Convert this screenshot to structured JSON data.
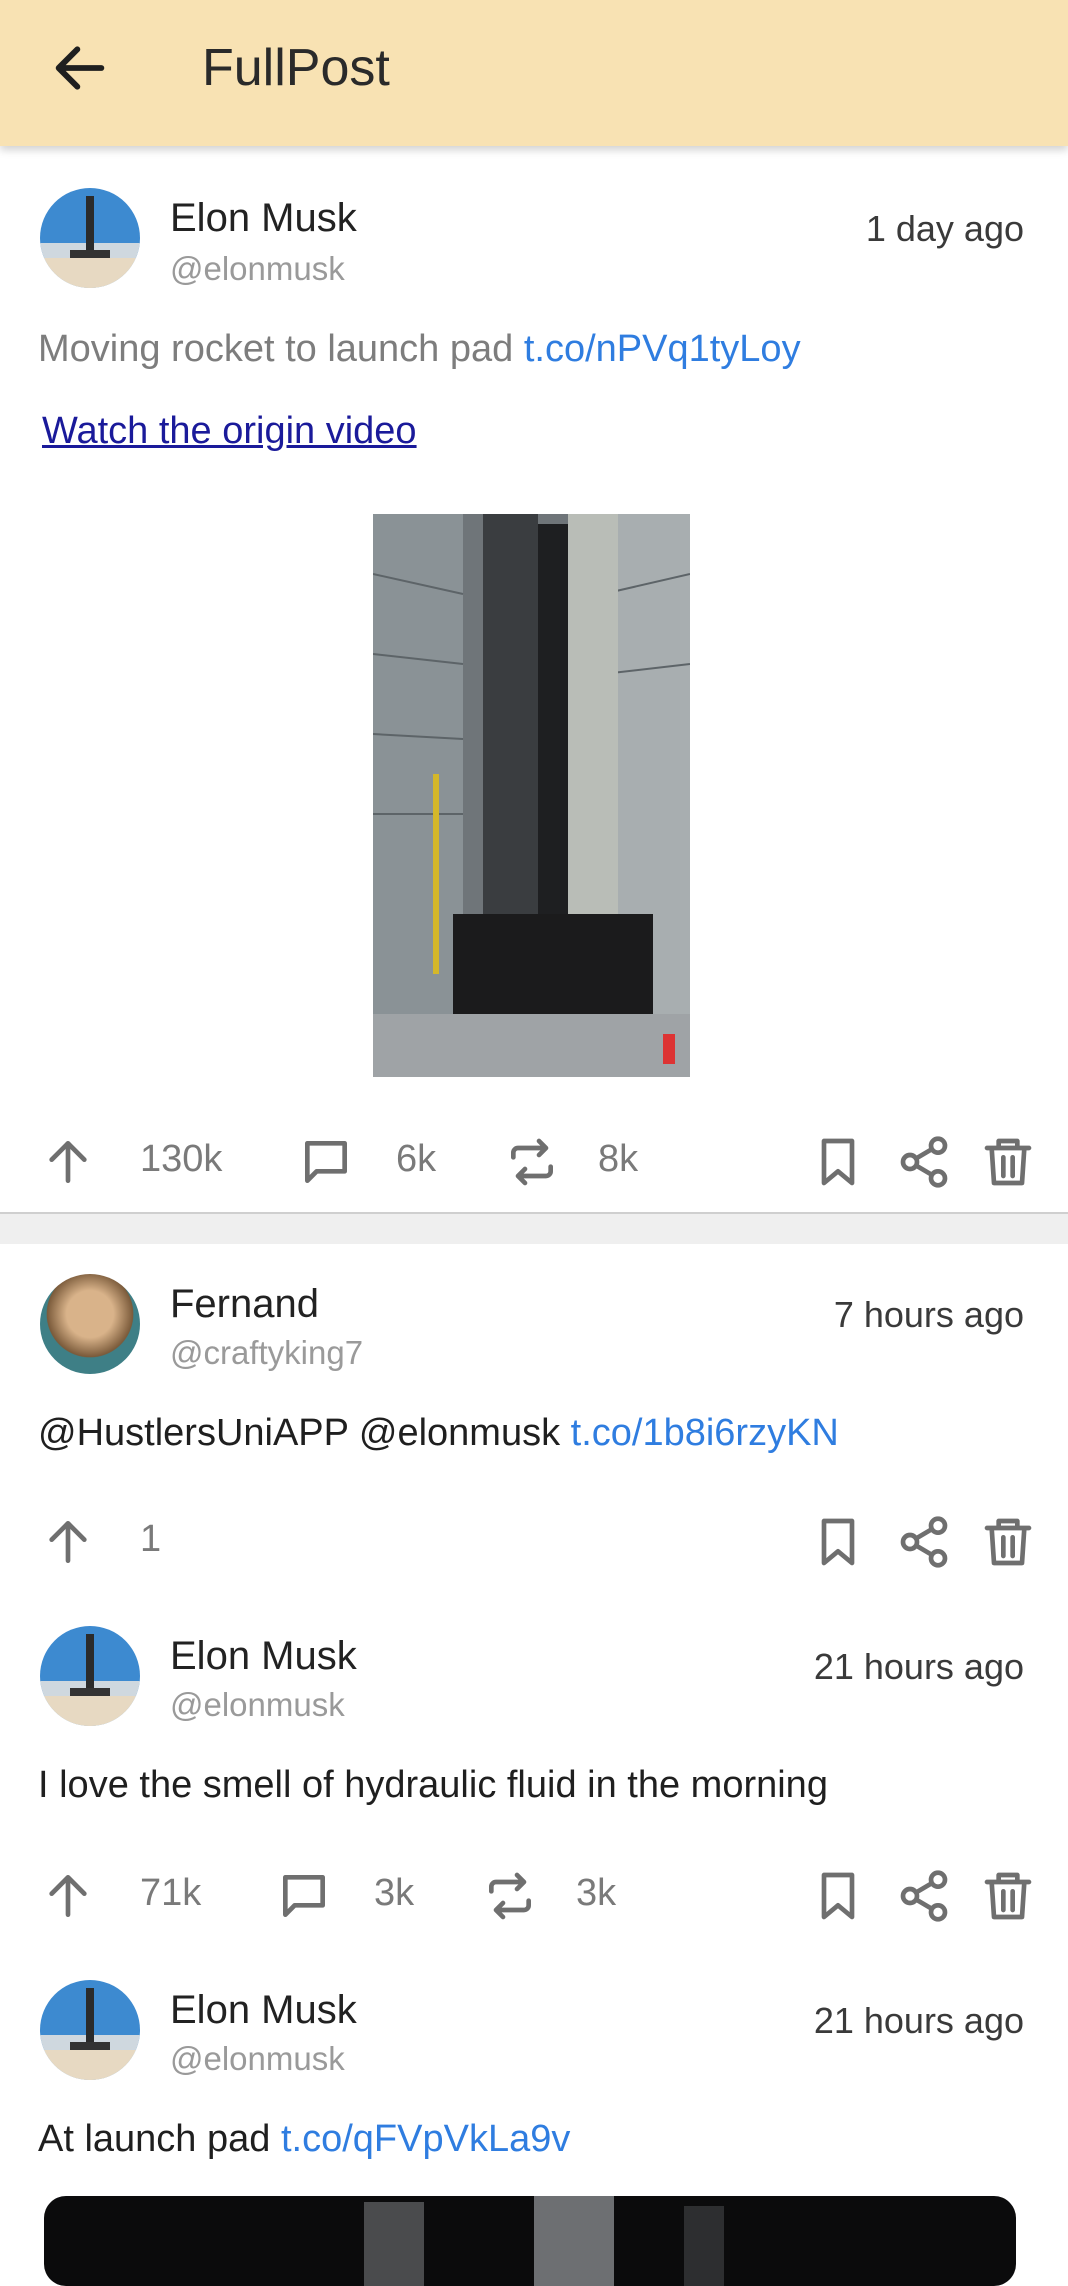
{
  "appbar": {
    "title": "FullPost",
    "back_icon": "arrow-left-icon",
    "color": "#f8e2b3"
  },
  "main_post": {
    "author": "Elon Musk",
    "handle": "@elonmusk",
    "time": "1 day ago",
    "text": "Moving rocket to launch pad",
    "link": "t.co/nPVq1tyLoy",
    "video_link": "Watch the origin video",
    "media_icon": "rocket-photo",
    "upvotes": "130k",
    "comments": "6k",
    "reposts": "8k"
  },
  "replies": [
    {
      "author": "Fernand",
      "handle": "@craftyking7",
      "time": "7 hours ago",
      "text": "@HustlersUniAPP @elonmusk",
      "link": "t.co/1b8i6rzyKN",
      "upvotes": "1"
    },
    {
      "author": "Elon Musk",
      "handle": "@elonmusk",
      "time": "21 hours ago",
      "text": "I love the smell of hydraulic fluid in the morning",
      "link": "",
      "upvotes": "71k",
      "comments": "3k",
      "reposts": "3k"
    },
    {
      "author": "Elon Musk",
      "handle": "@elonmusk",
      "time": "21 hours ago",
      "text": "At launch pad",
      "link": "t.co/qFVpVkLa9v"
    }
  ],
  "colors": {
    "link": "#2f7de0",
    "icon": "#6f6f6f"
  }
}
